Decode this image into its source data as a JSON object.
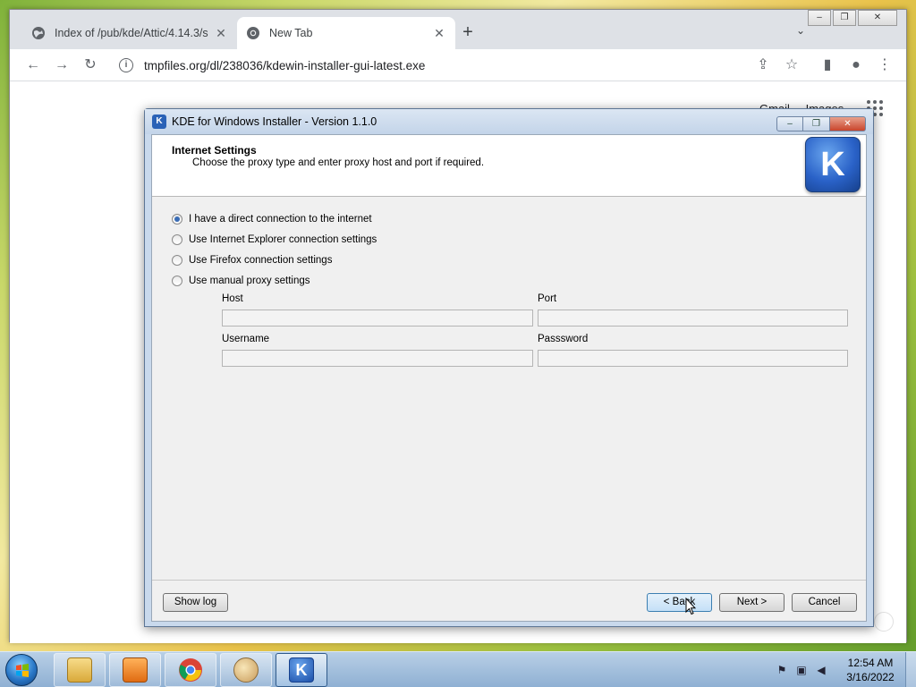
{
  "browser": {
    "tabs": [
      {
        "title": "Index of /pub/kde/Attic/4.14.3/s",
        "icon": "globe-icon",
        "active": false
      },
      {
        "title": "New Tab",
        "icon": "chrome-icon",
        "active": true
      }
    ],
    "new_tab_label": "+",
    "window_controls": {
      "minimize": "‒",
      "maximize": "❐",
      "close": "✕"
    },
    "url": "tmpfiles.org/dl/238036/kdewin-installer-gui-latest.exe",
    "page_links": [
      "Gmail",
      "Images"
    ]
  },
  "dialog": {
    "title": "KDE for Windows Installer - Version 1.1.0",
    "header_title": "Internet Settings",
    "header_subtitle": "Choose the proxy type and enter proxy host and port if required.",
    "logo_letter": "K",
    "options": [
      {
        "label": "I have a direct connection to the internet",
        "selected": true
      },
      {
        "label": "Use Internet Explorer connection settings",
        "selected": false
      },
      {
        "label": "Use Firefox connection settings",
        "selected": false
      },
      {
        "label": "Use manual proxy settings",
        "selected": false
      }
    ],
    "fields": {
      "host_label": "Host",
      "host_value": "",
      "port_label": "Port",
      "port_value": "",
      "username_label": "Username",
      "username_value": "",
      "password_label": "Passsword",
      "password_value": ""
    },
    "buttons": {
      "show_log": "Show log",
      "back": "< Back",
      "next": "Next >",
      "cancel": "Cancel"
    }
  },
  "taskbar": {
    "pinned": [
      "windows-explorer-icon",
      "media-player-icon",
      "chrome-icon",
      "paint-icon",
      "kde-installer-icon"
    ],
    "clock_time": "12:54 AM",
    "clock_date": "3/16/2022"
  },
  "colors": {
    "dialog_frame": "#c9d9ec",
    "kde_blue": "#2a62c8",
    "chrome_tabstrip": "#dee1e6"
  }
}
